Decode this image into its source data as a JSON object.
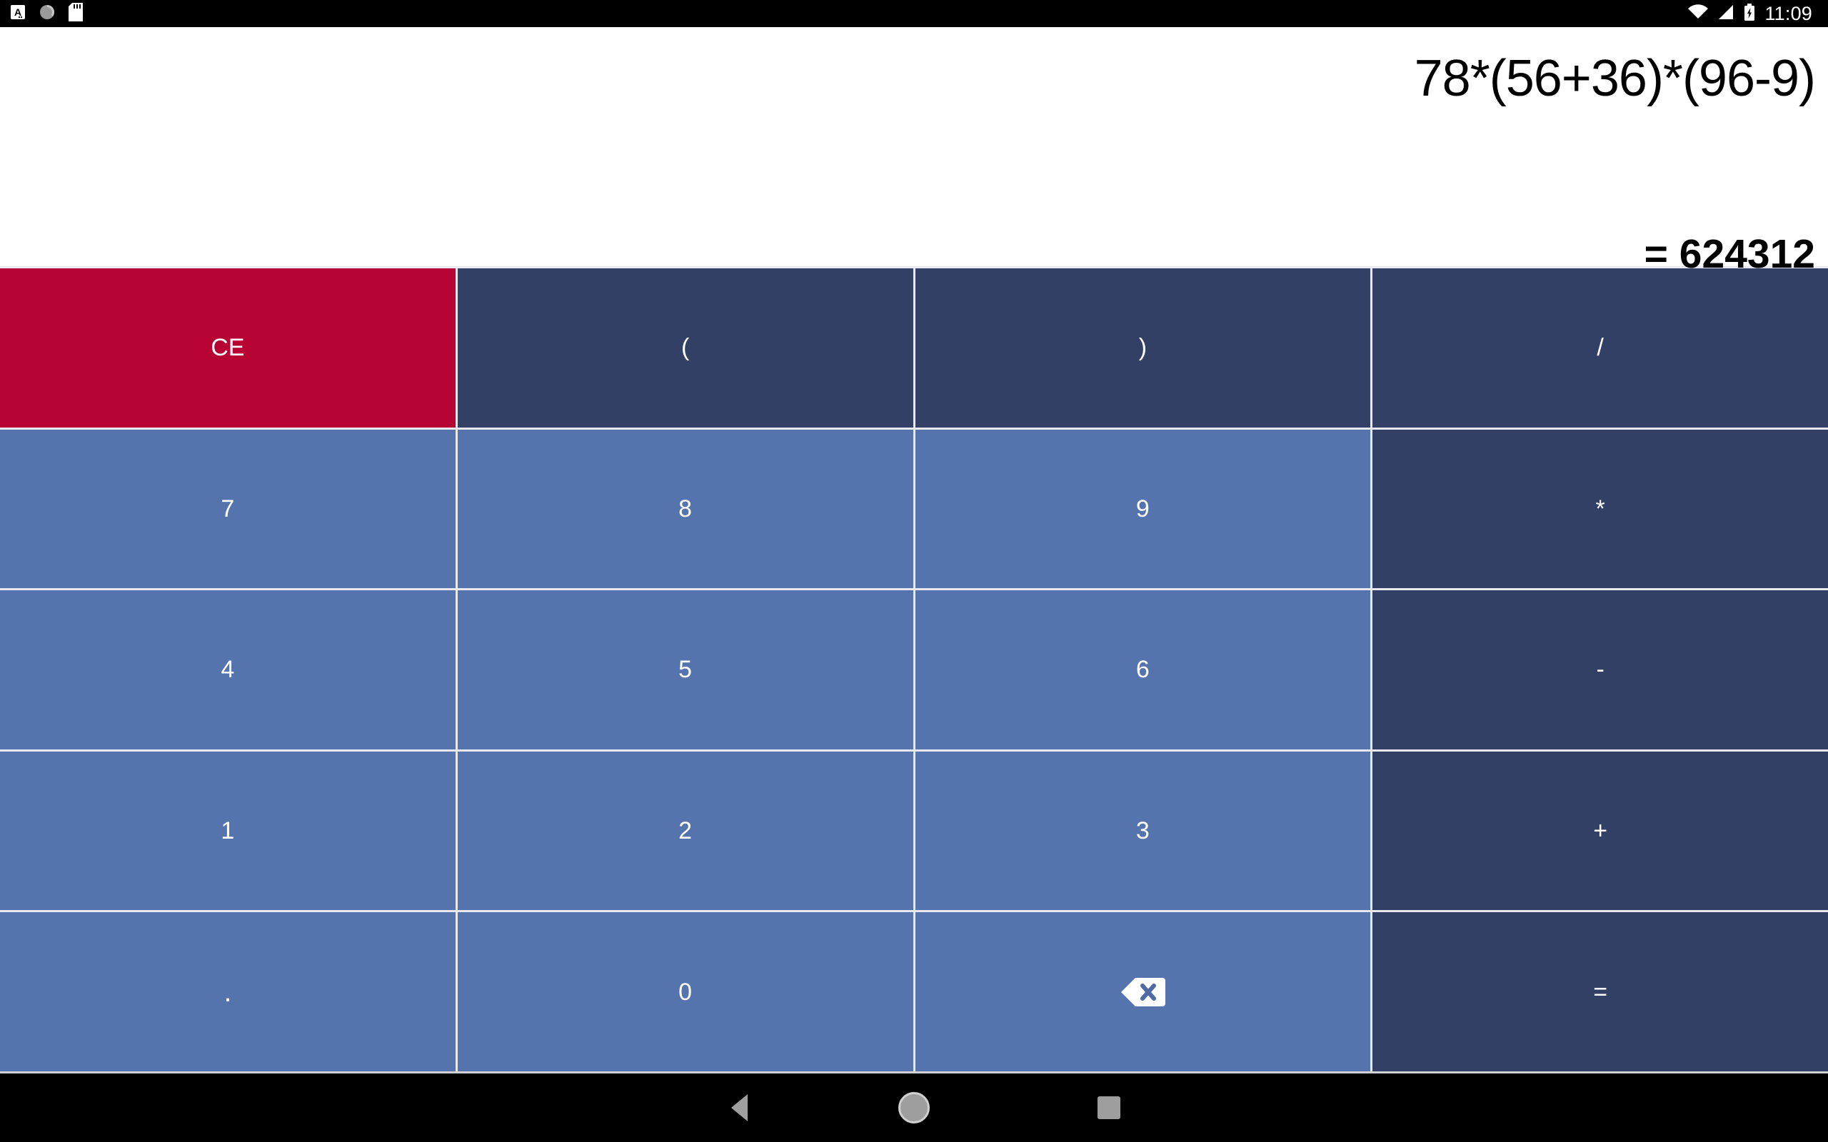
{
  "status_bar": {
    "icons": [
      "notification-letter-icon",
      "sync-circle-icon",
      "sd-card-icon"
    ],
    "right_icons": [
      "wifi-icon",
      "cellular-signal-icon",
      "battery-charging-icon"
    ],
    "clock": "11:09"
  },
  "display": {
    "expression": "78*(56+36)*(96-9)",
    "result": "= 624312"
  },
  "keypad": {
    "rows": [
      [
        {
          "label": "CE",
          "type": "clear",
          "name": "clear-entry-button"
        },
        {
          "label": "(",
          "type": "op",
          "name": "open-paren-button"
        },
        {
          "label": ")",
          "type": "op",
          "name": "close-paren-button"
        },
        {
          "label": "/",
          "type": "op",
          "name": "divide-button"
        }
      ],
      [
        {
          "label": "7",
          "type": "num",
          "name": "digit-7-button"
        },
        {
          "label": "8",
          "type": "num",
          "name": "digit-8-button"
        },
        {
          "label": "9",
          "type": "num",
          "name": "digit-9-button"
        },
        {
          "label": "*",
          "type": "op",
          "name": "multiply-button"
        }
      ],
      [
        {
          "label": "4",
          "type": "num",
          "name": "digit-4-button"
        },
        {
          "label": "5",
          "type": "num",
          "name": "digit-5-button"
        },
        {
          "label": "6",
          "type": "num",
          "name": "digit-6-button"
        },
        {
          "label": "-",
          "type": "op",
          "name": "minus-button"
        }
      ],
      [
        {
          "label": "1",
          "type": "num",
          "name": "digit-1-button"
        },
        {
          "label": "2",
          "type": "num",
          "name": "digit-2-button"
        },
        {
          "label": "3",
          "type": "num",
          "name": "digit-3-button"
        },
        {
          "label": "+",
          "type": "op",
          "name": "plus-button"
        }
      ],
      [
        {
          "label": ".",
          "type": "dot",
          "name": "decimal-point-button"
        },
        {
          "label": "0",
          "type": "num",
          "name": "digit-0-button"
        },
        {
          "label": "",
          "type": "num",
          "name": "backspace-button",
          "icon": "backspace-icon"
        },
        {
          "label": "=",
          "type": "op",
          "name": "equals-button"
        }
      ]
    ]
  },
  "nav_bar": {
    "back": "back-icon",
    "home": "home-icon",
    "recents": "recents-icon"
  },
  "colors": {
    "clear_red": "#b80434",
    "operator_navy": "#334066",
    "number_blue": "#5574ad",
    "display_bg": "#ffffff",
    "system_bar": "#000000"
  }
}
